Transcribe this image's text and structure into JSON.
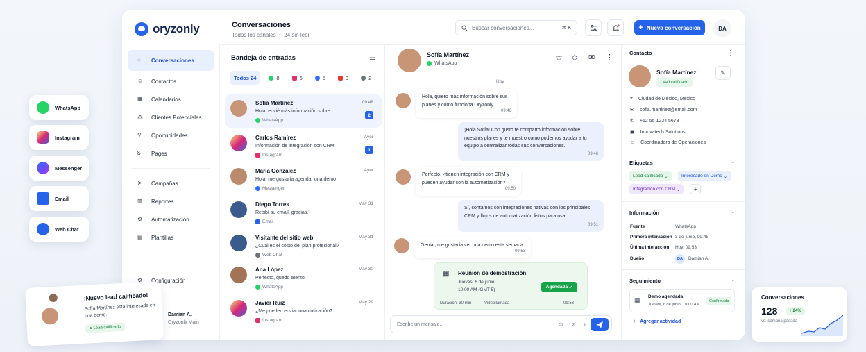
{
  "app": {
    "brand": "oryzonly"
  },
  "header": {
    "title": "Conversaciones",
    "subtitle_a": "Todos los canales",
    "subtitle_b": "24 sin leer",
    "search_placeholder": "Buscar conversaciones...",
    "search_shortcut": "⌘ K",
    "new_button": "Nueva conversación",
    "avatar_initials": "DA"
  },
  "nav": {
    "items": [
      {
        "label": "Conversaciones",
        "icon": "chat-icon"
      },
      {
        "label": "Contactos",
        "icon": "contacts-icon"
      },
      {
        "label": "Calendarios",
        "icon": "calendar-icon"
      },
      {
        "label": "Clientes Potenciales",
        "icon": "leads-icon"
      },
      {
        "label": "Oportunidades",
        "icon": "opportunities-icon"
      },
      {
        "label": "Pages",
        "icon": "pages-icon"
      },
      {
        "label": "Campañas",
        "icon": "campaigns-icon"
      },
      {
        "label": "Reportes",
        "icon": "reports-icon"
      },
      {
        "label": "Automatización",
        "icon": "automation-icon"
      },
      {
        "label": "Plantillas",
        "icon": "templates-icon"
      }
    ],
    "settings": "Configuración",
    "user_name": "Damian A.",
    "user_org": "Oryzonly Main"
  },
  "inbox": {
    "title": "Bandeja de entradas",
    "filters": [
      {
        "label": "Todos 24"
      },
      {
        "label": "8",
        "icon": "whatsapp-icon"
      },
      {
        "label": "6",
        "icon": "instagram-icon"
      },
      {
        "label": "5",
        "icon": "messenger-icon"
      },
      {
        "label": "3",
        "icon": "email-icon"
      },
      {
        "label": "2",
        "icon": "webchat-icon"
      }
    ],
    "conversations": [
      {
        "name": "Sofía Martínez",
        "message": "Hola, envié más información sobre...",
        "channel": "WhatsApp",
        "time": "09:48",
        "badge": "2"
      },
      {
        "name": "Carlos Ramírez",
        "message": "Información de integración con CRM",
        "channel": "Instagram",
        "time": "Ayer",
        "badge": "1"
      },
      {
        "name": "María González",
        "message": "Hola, me gustaría agendar una demo",
        "channel": "Messenger",
        "time": "Ayer",
        "badge": ""
      },
      {
        "name": "Diego Torres",
        "message": "Recibí su email, gracias.",
        "channel": "Email",
        "time": "May 31",
        "badge": ""
      },
      {
        "name": "Visitante del sitio web",
        "message": "¿Cuál es el costo del plan profesional?",
        "channel": "Web Chat",
        "time": "May 31",
        "badge": ""
      },
      {
        "name": "Ana López",
        "message": "Perfecto, quedo atento.",
        "channel": "WhatsApp",
        "time": "May 30",
        "badge": ""
      },
      {
        "name": "Javier Ruiz",
        "message": "¿Me pueden enviar una cotización?",
        "channel": "Instagram",
        "time": "May 29",
        "badge": ""
      }
    ]
  },
  "chat": {
    "contact_name": "Sofía Martínez",
    "contact_channel": "WhatsApp",
    "day_label": "Hoy",
    "messages": [
      {
        "dir": "in",
        "text": "Hola, quiero más información sobre sus planes y cómo funciona Oryzonly.",
        "time": "09:46"
      },
      {
        "dir": "out",
        "text": "¡Hola Sofía! Con gusto te comparto información sobre nuestros planes y te muestro cómo podemos ayudar a tu equipo a centralizar todas sus conversaciones.",
        "time": "09:46"
      },
      {
        "dir": "in",
        "text": "Perfecto, ¿tienen integración con CRM y pueden ayudar con la automatización?",
        "time": "09:50"
      },
      {
        "dir": "out",
        "text": "Sí, contamos con integraciones nativas con los principales CRM y flujos de automatización listos para usar.",
        "time": "09:51"
      },
      {
        "dir": "in",
        "text": "Genial, me gustaría ver una demo esta semana.",
        "time": "09:53"
      }
    ],
    "meeting": {
      "title": "Reunión de demostración",
      "date": "Jueves, 6 de junio",
      "time": "10:00 AM (GMT-5)",
      "status": "Agendada",
      "duration": "Duración: 30 min",
      "mode": "Videollamada",
      "sent": "09:53"
    },
    "composer_placeholder": "Escribe un mensaje..."
  },
  "contact": {
    "section": "Contacto",
    "name": "Sofía Martínez",
    "badge": "Lead calificado",
    "city": "Ciudad de México, México",
    "email": "sofia.martinez@email.com",
    "phone": "+52 55 1234 5678",
    "company": "Innovatech Solutions",
    "role": "Coordinadora de Operaciones",
    "tags_title": "Etiquetas",
    "tags": [
      "Lead calificado",
      "Interesado en Demo",
      "Integración con CRM"
    ],
    "info_title": "Información",
    "info": [
      {
        "k": "Fuente",
        "v": "WhatsApp"
      },
      {
        "k": "Primera interacción",
        "v": "3 de junio, 09:48"
      },
      {
        "k": "Última interacción",
        "v": "Hoy, 09:53"
      },
      {
        "k": "Dueño",
        "v": "Damian A."
      }
    ],
    "owner_initials": "DA",
    "follow_title": "Seguimiento",
    "follow_item": "Demo agendada",
    "follow_date": "Jueves, 6 de junio, 10:00 AM",
    "follow_status": "Confirmada",
    "add_activity": "Agregar actividad"
  },
  "floating": {
    "channels": [
      "WhatsApp",
      "Instagram",
      "Messenger",
      "Email",
      "Web Chat"
    ],
    "lead_title": "¡Nuevo lead calificado!",
    "lead_text": "Sofía Martínez está interesada en una demo.",
    "lead_badge": "Lead calificado",
    "stats_title": "Conversaciones",
    "stats_value": "128",
    "stats_delta": "↑ 24%",
    "stats_caption": "vs. semana pasada"
  },
  "colors": {
    "accent": "#2563eb",
    "whatsapp": "#25d366",
    "instagram": "#e1306c",
    "messenger": "#2f6bff",
    "email": "#e53935"
  }
}
